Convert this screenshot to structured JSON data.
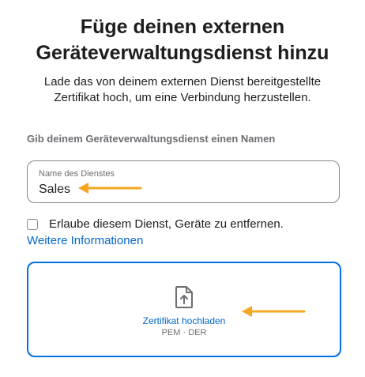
{
  "header": {
    "title_line1": "Füge deinen externen",
    "title_line2": "Geräteverwaltungsdienst hinzu",
    "subtitle_line1": "Lade das von deinem externen Dienst bereitgestellte",
    "subtitle_line2": "Zertifikat hoch, um eine Verbindung herzustellen."
  },
  "form": {
    "section_label": "Gib deinem Geräteverwaltungsdienst einen Namen",
    "service_name": {
      "label": "Name des Dienstes",
      "value": "Sales"
    },
    "allow_remove": {
      "label": "Erlaube diesem Dienst, Geräte zu entfernen.",
      "checked": false
    },
    "more_info_link": "Weitere Informationen"
  },
  "upload": {
    "label": "Zertifikat hochladen",
    "formats": "PEM · DER",
    "icon": "document-upload-icon"
  },
  "annotations": {
    "arrow_color": "#f5a623"
  },
  "colors": {
    "accent": "#0071e3",
    "link": "#0066cc",
    "text": "#1d1d1f",
    "secondary_text": "#6e6e73"
  }
}
